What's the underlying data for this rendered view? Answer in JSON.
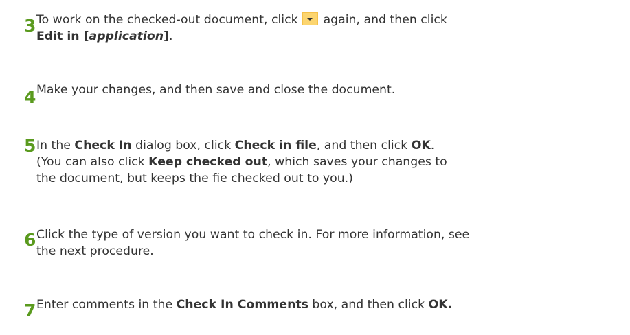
{
  "steps": [
    {
      "number": "3",
      "line1_pre": "To work on the checked-out document, click",
      "button_icon": "dropdown-arrow-icon",
      "line1_post": "again, and then click",
      "line2_bold": "Edit in [",
      "line2_italic": "application",
      "line2_bold_end": "]",
      "line2_end": "."
    },
    {
      "number": "4",
      "text": "Make your changes, and then save and close the document."
    },
    {
      "number": "5",
      "t1": "In the ",
      "b1": "Check In",
      "t2": " dialog box, click ",
      "b2": "Check in file",
      "t3": ", and then click ",
      "b3": "OK",
      "t4": ".",
      "t5": "(You can also click ",
      "b4": "Keep checked out",
      "t6": ", which saves your changes to",
      "t7": "the document, but keeps the fie checked out to you.)"
    },
    {
      "number": "6",
      "line1": "Click the type of version you want to check in. For more information, see",
      "line2": "the next procedure."
    },
    {
      "number": "7",
      "t1": "Enter comments in the ",
      "b1": "Check In Comments",
      "t2": " box, and then click ",
      "b2": "OK."
    }
  ],
  "colors": {
    "step_number": "#5a9a1e",
    "body_text": "#333333",
    "button_fill": "#fcd56f"
  }
}
